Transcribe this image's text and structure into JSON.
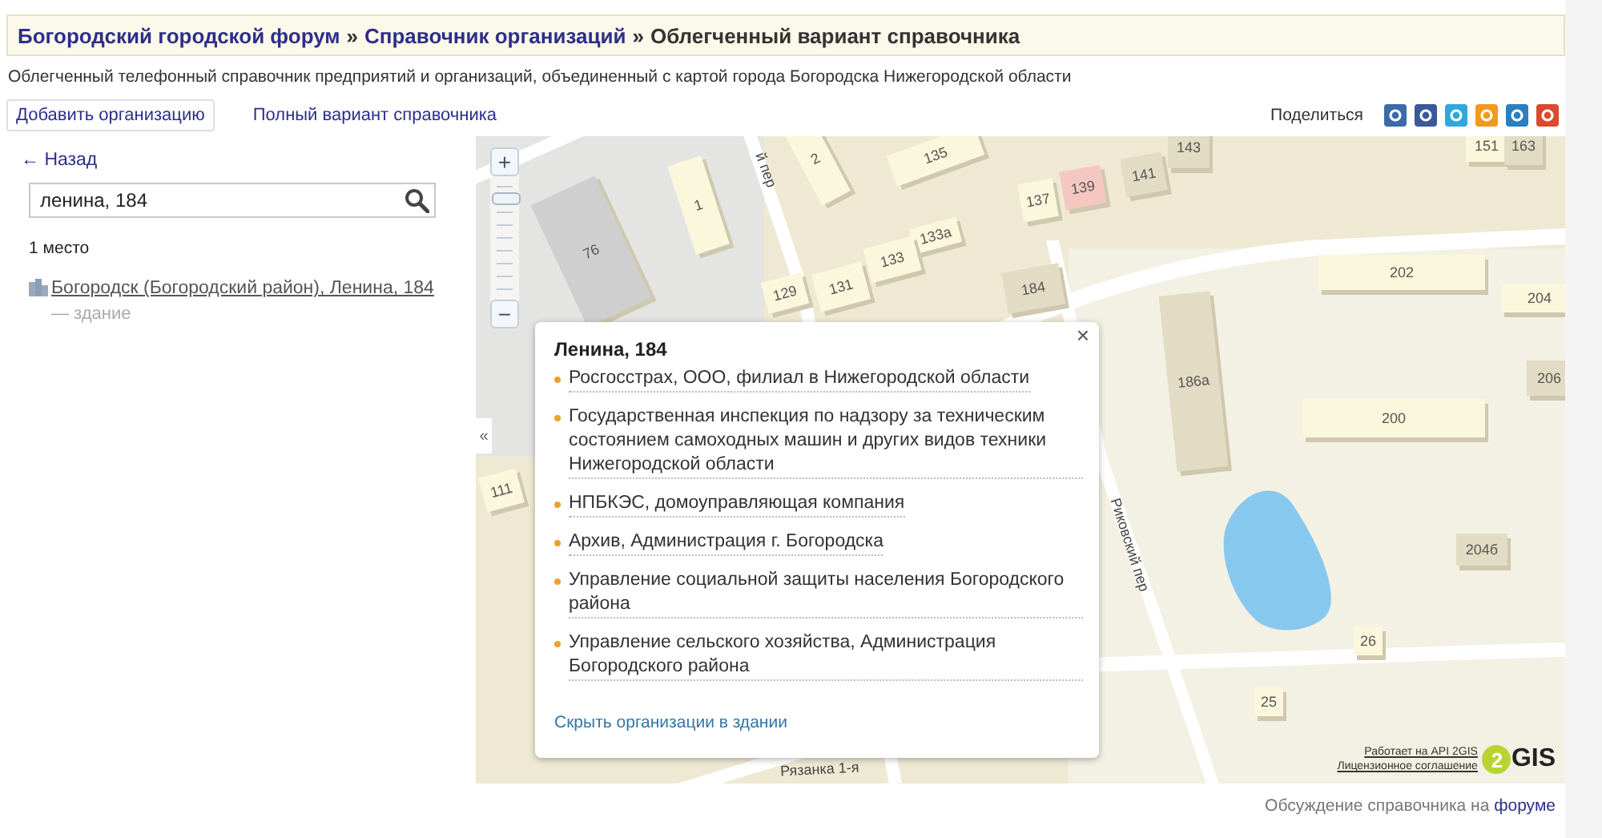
{
  "breadcrumb": [
    {
      "label": "Богородский городской форум",
      "kind": "link"
    },
    {
      "label": "»",
      "kind": "sep"
    },
    {
      "label": "Справочник организаций",
      "kind": "link"
    },
    {
      "label": "»",
      "kind": "sep"
    },
    {
      "label": "Облегченный вариант справочника",
      "kind": "current"
    }
  ],
  "description": "Облегченный телефонный справочник предприятий и организаций, объединенный с картой города Богородска Нижегородской области",
  "toolbar": {
    "add_button": "Добавить организацию",
    "full_link": "Полный вариант справочника",
    "share_label": "Поделиться"
  },
  "sidebar": {
    "back": "← Назад",
    "search": {
      "value": "ленина, 184"
    },
    "count": "1 место",
    "result": {
      "link": "Богородск (Богородский район), Ленина, 184",
      "note": "— здание"
    }
  },
  "map": {
    "collapse": "«",
    "zoom_in": "+",
    "zoom_out": "−",
    "buildings": [
      "1",
      "2",
      "135",
      "143",
      "151",
      "163",
      "137",
      "139",
      "141",
      "76",
      "133а",
      "133",
      "131",
      "129",
      "184",
      "186а",
      "202",
      "204",
      "206",
      "200",
      "204б",
      "26",
      "25",
      "111"
    ],
    "streets": [
      "й пер",
      "Риковский пер",
      "Рязанка 1-я"
    ],
    "popup": {
      "title": "Ленина, 184",
      "close": "×",
      "items": [
        "Росгосстрах, ООО, филиал в Нижегородской области",
        "Государственная инспекция по надзору за техническим состоянием самоходных машин и других видов техники Нижегородской области",
        "НПБКЭС, домоуправляющая компания",
        "Архив, Администрация г. Богородска",
        "Управление социальной защиты населения Богородского района",
        "Управление сельского хозяйства, Администрация Богородского района"
      ],
      "hide_link": "Скрыть организации в здании"
    },
    "attribution": {
      "powered": "Работает на API 2GIS",
      "license": "Лицензионное соглашение",
      "logo_digit": "2",
      "logo_text": "GIS"
    }
  },
  "footer": {
    "text": "Обсуждение справочника на",
    "link": "форуме"
  }
}
